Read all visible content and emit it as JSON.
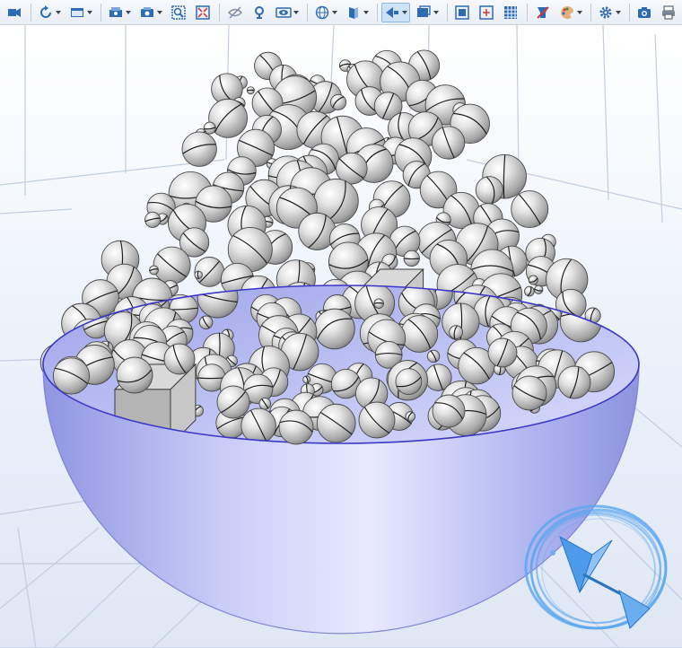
{
  "toolbar": {
    "items": [
      {
        "name": "go-to-default-view",
        "icon": "camera-home-icon",
        "dropdown": false,
        "active": false
      },
      {
        "name": "rotate",
        "icon": "rotate-icon",
        "dropdown": true,
        "active": false
      },
      {
        "name": "view-options",
        "icon": "view-window-icon",
        "dropdown": true,
        "active": false
      },
      {
        "name": "select-objects",
        "icon": "select-object-icon",
        "dropdown": true,
        "active": false
      },
      {
        "name": "select-box",
        "icon": "select-box-icon",
        "dropdown": true,
        "active": false
      },
      {
        "name": "zoom-box",
        "icon": "zoom-box-icon",
        "dropdown": false,
        "active": false
      },
      {
        "name": "zoom-extents",
        "icon": "zoom-extents-icon",
        "dropdown": false,
        "active": false
      },
      {
        "name": "hide-selected",
        "icon": "hide-icon",
        "dropdown": false,
        "active": false
      },
      {
        "name": "reset-hiding",
        "icon": "reset-hiding-icon",
        "dropdown": false,
        "active": false
      },
      {
        "name": "show-hidden",
        "icon": "eye-icon",
        "dropdown": true,
        "active": false
      },
      {
        "name": "wireframe-rendering",
        "icon": "wireframe-icon",
        "dropdown": true,
        "active": false
      },
      {
        "name": "transparency",
        "icon": "transparency-icon",
        "dropdown": true,
        "active": false
      },
      {
        "name": "lighting",
        "icon": "light-icon",
        "dropdown": true,
        "active": true
      },
      {
        "name": "scene-light",
        "icon": "scene-light-icon",
        "dropdown": true,
        "active": false
      },
      {
        "name": "show-grid",
        "icon": "grid-icon",
        "dropdown": false,
        "active": false
      },
      {
        "name": "show-axis",
        "icon": "axis-icon",
        "dropdown": false,
        "active": false
      },
      {
        "name": "show-selection",
        "icon": "selection-grid-icon",
        "dropdown": false,
        "active": false
      },
      {
        "name": "clear-highlight",
        "icon": "clear-icon",
        "dropdown": false,
        "active": false
      },
      {
        "name": "color-palette",
        "icon": "palette-icon",
        "dropdown": true,
        "active": false
      },
      {
        "name": "render-settings",
        "icon": "gear-icon",
        "dropdown": true,
        "active": false
      },
      {
        "name": "image-snapshot",
        "icon": "camera-icon",
        "dropdown": false,
        "active": false
      },
      {
        "name": "print",
        "icon": "print-icon",
        "dropdown": false,
        "active": false
      }
    ],
    "separators_after": [
      0,
      2,
      6,
      9,
      11,
      13,
      16,
      18,
      19
    ]
  },
  "colors": {
    "bowl_fill": "#b8bdf2",
    "bowl_edge": "#3c38c8",
    "ball_fill": "#d8d8d8",
    "ball_edge": "#4a4a4a",
    "grid_line": "#c2cee0",
    "axis_glyph": "#5aa6ef",
    "toolbar_icon": "#2e6bb5"
  }
}
